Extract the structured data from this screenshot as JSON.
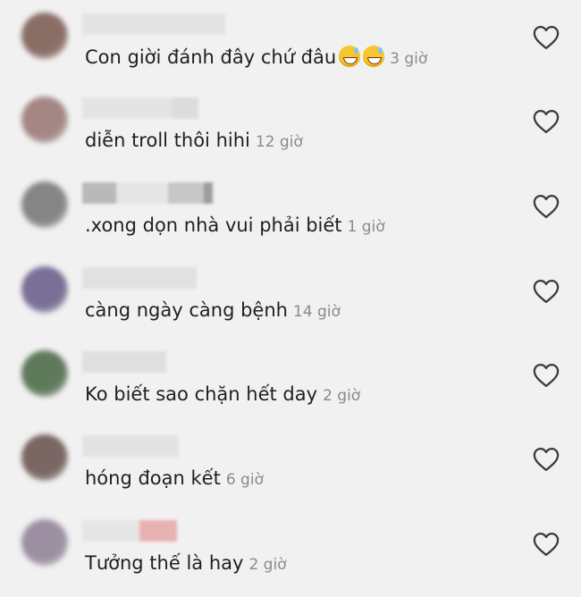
{
  "comments": [
    {
      "text": "Con giời đánh đây chứ đâu",
      "time": "3 giờ",
      "emojis": [
        "grinning-sweat-emoji",
        "grinning-sweat-emoji"
      ],
      "avatar_color": "#8a6e66",
      "username_blocks": [
        "#e3e3e3"
      ]
    },
    {
      "text": "diễn troll thôi hihi",
      "time": "12 giờ",
      "emojis": [],
      "avatar_color": "#a48685",
      "username_blocks": [
        "#e4e4e4",
        "#dcdcdc"
      ]
    },
    {
      "text": ".xong dọn nhà vui phải biết",
      "time": "1 giờ",
      "emojis": [],
      "avatar_color": "#858585",
      "username_blocks": [
        "#b9b9b9",
        "#e5e5e5",
        "#c7c7c7",
        "#9d9d9d"
      ]
    },
    {
      "text": "càng ngày càng bệnh",
      "time": "14 giờ",
      "emojis": [],
      "avatar_color": "#7a6f97",
      "username_blocks": [
        "#e1e1e1"
      ]
    },
    {
      "text": "Ko biết sao chặn hết day",
      "time": "2 giờ",
      "emojis": [],
      "avatar_color": "#5f7a5b",
      "username_blocks": [
        "#dfdfdf"
      ]
    },
    {
      "text": "hóng đoạn kết",
      "time": "6 giờ",
      "emojis": [],
      "avatar_color": "#7a6662",
      "username_blocks": [
        "#e2e2e2"
      ]
    },
    {
      "text": "Tưởng thế là hay",
      "time": "2 giờ",
      "emojis": [],
      "avatar_color": "#9c8fa2",
      "username_blocks": [
        "#e6e6e6",
        "#e9b2b2"
      ]
    }
  ],
  "icons": {
    "like": "heart-outline-icon"
  },
  "colors": {
    "background": "#f1f1f1",
    "text": "#1f1f1f",
    "time": "#8a8a8a",
    "heart_stroke": "#3a3a3a"
  }
}
